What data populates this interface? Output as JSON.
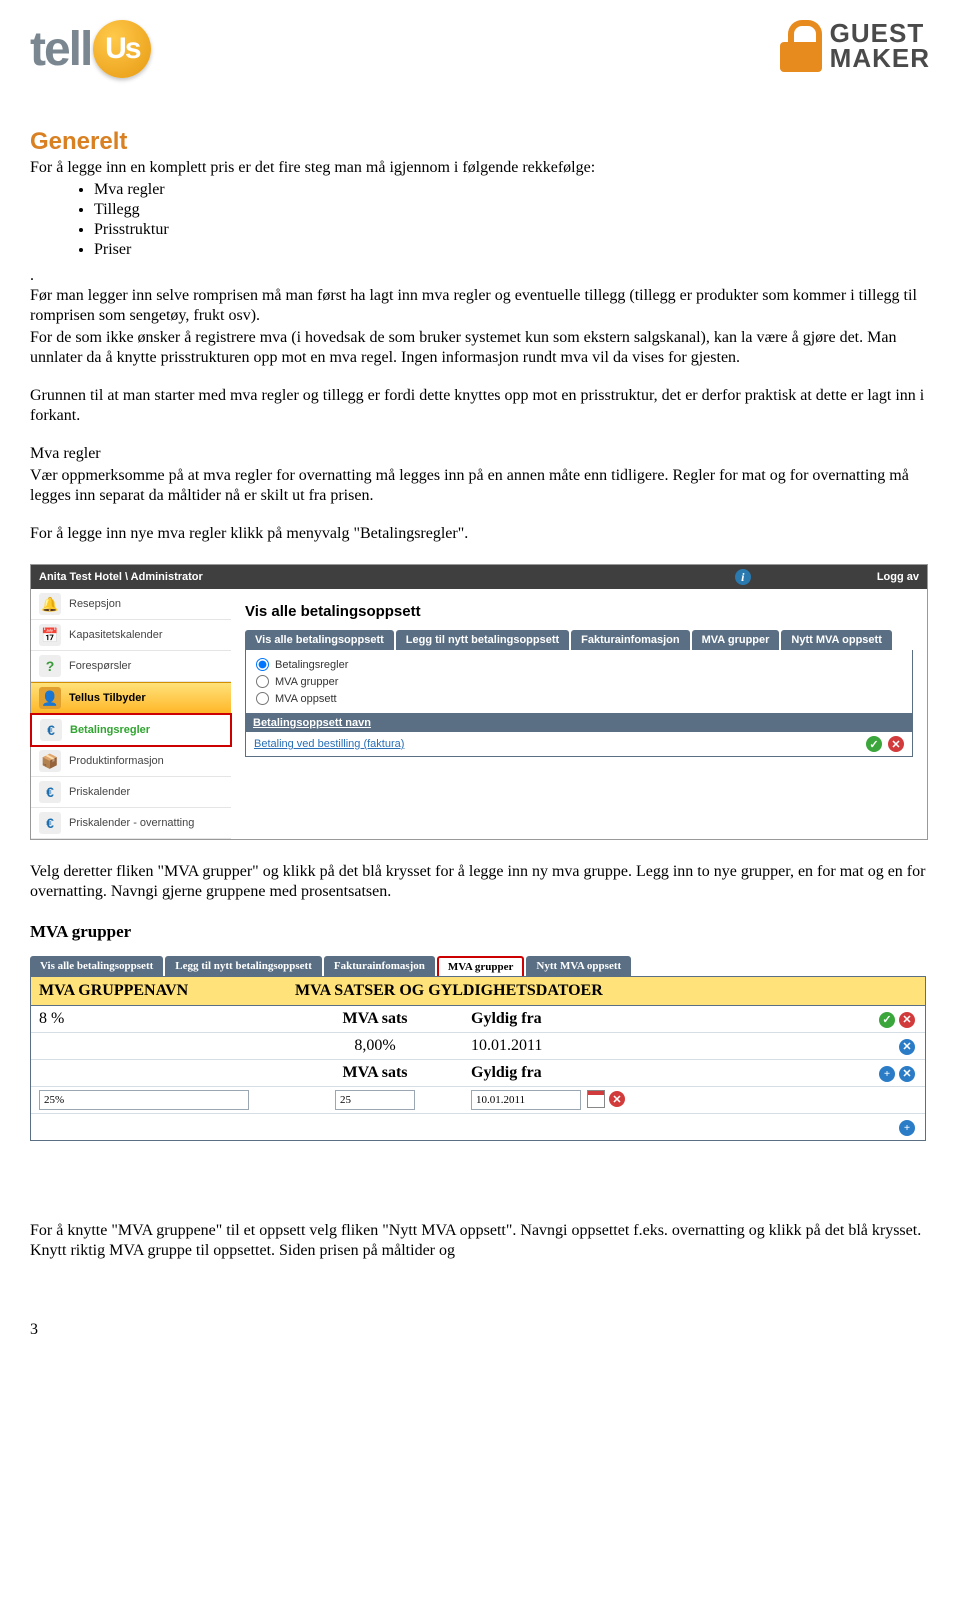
{
  "logos": {
    "tellus_part1": "tell",
    "tellus_part2": "Us",
    "gm_line1": "GUEST",
    "gm_line2": "MAKER"
  },
  "headings": {
    "generelt": "Generelt",
    "mva_grupper": "MVA grupper"
  },
  "text": {
    "intro": "For å legge inn en komplett pris er det fire steg man må igjennom i følgende rekkefølge:",
    "steps": [
      "Mva regler",
      "Tillegg",
      "Prisstruktur",
      "Priser"
    ],
    "dot": ".",
    "para1": "Før man legger inn selve romprisen må man først ha lagt inn mva regler og eventuelle tillegg (tillegg er produkter som kommer i tillegg til romprisen som sengetøy, frukt osv).",
    "para2": "For de som ikke ønsker å registrere mva (i hovedsak de som bruker systemet kun som ekstern salgskanal), kan la være å  gjøre det. Man unnlater da å knytte prisstrukturen opp mot en mva regel. Ingen informasjon rundt mva vil da vises for gjesten.",
    "para3": "Grunnen til at man starter med mva regler og tillegg er fordi dette knyttes opp mot en prisstruktur, det er derfor praktisk at dette er lagt inn i forkant.",
    "mva_regler_label": " Mva regler",
    "para4": "Vær oppmerksomme på at mva regler for overnatting må legges inn på en annen måte enn tidligere. Regler for mat og for overnatting må legges inn separat da måltider nå er skilt ut fra prisen.",
    "para5": " For å legge inn nye mva regler klikk på menyvalg \"Betalingsregler\".",
    "para6": "Velg deretter fliken \"MVA grupper\" og klikk på det blå krysset for å legge inn ny mva gruppe. Legg inn to nye grupper, en for mat og en for overnatting.  Navngi gjerne gruppene med prosentsatsen.",
    "para7": "For å knytte \"MVA gruppene\" til et oppsett velg fliken \"Nytt MVA oppsett\".  Navngi oppsettet f.eks. overnatting og klikk på det blå krysset. Knytt riktig MVA gruppe til oppsettet. Siden prisen på måltider og"
  },
  "shot1": {
    "breadcrumb": "Anita Test Hotel \\ Administrator",
    "logout": "Logg av",
    "sidebar": [
      "Resepsjon",
      "Kapasitetskalender",
      "Forespørsler",
      "Tellus Tilbyder",
      "Betalingsregler",
      "Produktinformasjon",
      "Priskalender",
      "Priskalender - overnatting"
    ],
    "panel_title": "Vis alle betalingsoppsett",
    "tabs": [
      "Vis alle betalingsoppsett",
      "Legg til nytt betalingsoppsett",
      "Fakturainfomasjon",
      "MVA grupper",
      "Nytt MVA oppsett"
    ],
    "radios": [
      "Betalingsregler",
      "MVA grupper",
      "MVA oppsett"
    ],
    "subhead": "Betalingsoppsett navn",
    "list_item": "Betaling ved bestilling (faktura)"
  },
  "shot2": {
    "tabs": [
      "Vis alle betalingsoppsett",
      "Legg til nytt betalingsoppsett",
      "Fakturainfomasjon",
      "MVA grupper",
      "Nytt MVA oppsett"
    ],
    "header_cols": [
      "MVA GRUPPENAVN",
      "MVA SATSER OG GYLDIGHETSDATOER"
    ],
    "sub_cols": [
      "MVA sats",
      "Gyldig fra"
    ],
    "row1": {
      "name": "8 %",
      "sats": "8,00%",
      "fra": "10.01.2011"
    },
    "row2": {
      "name": "25%",
      "sats": "25",
      "fra": "10.01.2011"
    }
  },
  "page_number": "3"
}
